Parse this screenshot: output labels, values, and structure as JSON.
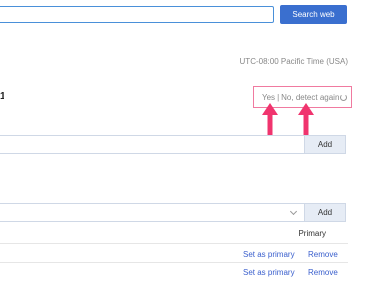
{
  "search": {
    "value": "",
    "button_label": "Search web"
  },
  "timezone": {
    "current": "UTC-08:00 Pacific Time (USA)"
  },
  "detect_prompt": {
    "yes_label": "Yes",
    "separator": "|",
    "no_label": "No, detect again"
  },
  "email_add": {
    "value": "",
    "add_label": "Add"
  },
  "phone_add": {
    "selected": "",
    "add_label": "Add"
  },
  "table": {
    "header_primary": "Primary",
    "rows": [
      {
        "action_primary": "Set as primary",
        "action_remove": "Remove"
      },
      {
        "action_primary": "Set as primary",
        "action_remove": "Remove"
      }
    ]
  },
  "annotation": {
    "color": "#f0346e"
  }
}
